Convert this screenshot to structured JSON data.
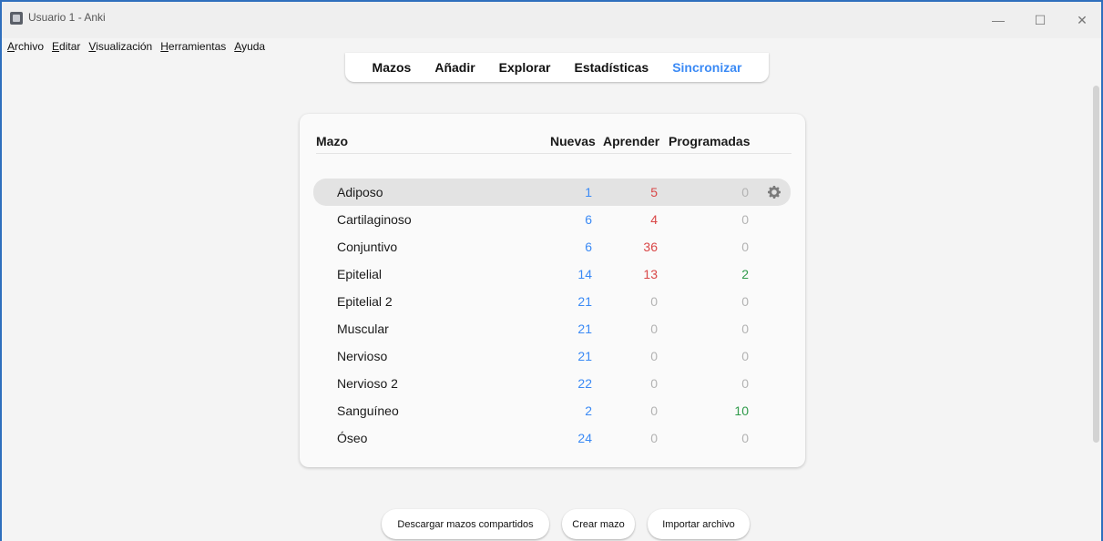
{
  "window": {
    "title": "Usuario 1 - Anki"
  },
  "menubar": [
    {
      "label": "Archivo",
      "mnemonic": "A",
      "rest": "rchivo"
    },
    {
      "label": "Editar",
      "mnemonic": "E",
      "rest": "ditar"
    },
    {
      "label": "Visualización",
      "mnemonic": "V",
      "rest": "isualización"
    },
    {
      "label": "Herramientas",
      "mnemonic": "H",
      "rest": "erramientas"
    },
    {
      "label": "Ayuda",
      "mnemonic": "A",
      "rest": "yuda"
    }
  ],
  "toolbar": {
    "decks": "Mazos",
    "add": "Añadir",
    "browse": "Explorar",
    "stats": "Estadísticas",
    "sync": "Sincronizar"
  },
  "table": {
    "headers": {
      "deck": "Mazo",
      "new": "Nuevas",
      "learn": "Aprender",
      "due": "Programadas"
    },
    "rows": [
      {
        "name": "Adiposo",
        "new": "1",
        "learn": "5",
        "due": "0",
        "current": true
      },
      {
        "name": "Cartilaginoso",
        "new": "6",
        "learn": "4",
        "due": "0"
      },
      {
        "name": "Conjuntivo",
        "new": "6",
        "learn": "36",
        "due": "0"
      },
      {
        "name": "Epitelial",
        "new": "14",
        "learn": "13",
        "due": "2"
      },
      {
        "name": "Epitelial 2",
        "new": "21",
        "learn": "0",
        "due": "0"
      },
      {
        "name": "Muscular",
        "new": "21",
        "learn": "0",
        "due": "0"
      },
      {
        "name": "Nervioso",
        "new": "21",
        "learn": "0",
        "due": "0"
      },
      {
        "name": "Nervioso 2",
        "new": "22",
        "learn": "0",
        "due": "0"
      },
      {
        "name": "Sanguíneo",
        "new": "2",
        "learn": "0",
        "due": "10"
      },
      {
        "name": "Óseo",
        "new": "24",
        "learn": "0",
        "due": "0"
      }
    ]
  },
  "buttons": {
    "shared": "Descargar mazos compartidos",
    "create": "Crear mazo",
    "import": "Importar archivo"
  },
  "colors": {
    "new": "#3b8af5",
    "learn": "#d94646",
    "due": "#2f9a4a",
    "zero": "#b3b3b3"
  }
}
